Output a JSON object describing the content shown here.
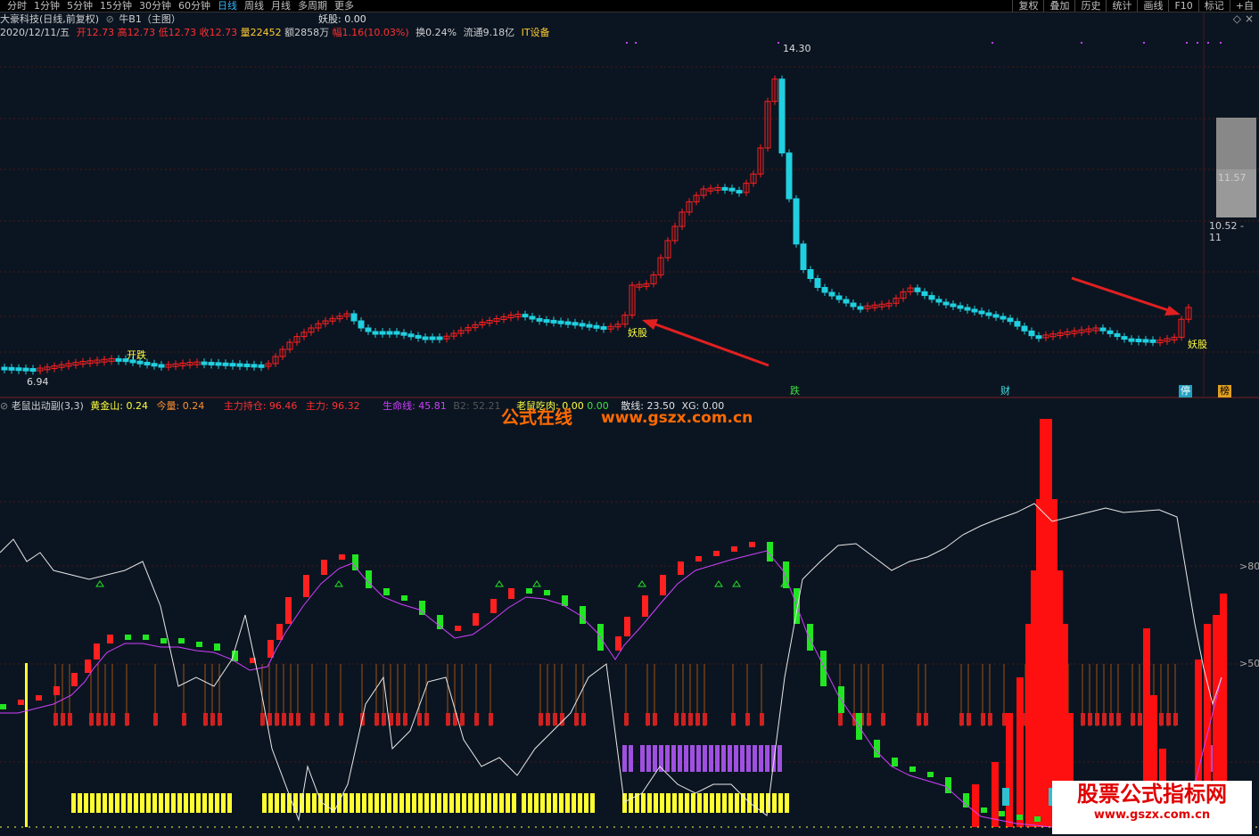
{
  "timeframe_tabs": [
    {
      "label": "分时",
      "active": false
    },
    {
      "label": "1分钟",
      "active": false
    },
    {
      "label": "5分钟",
      "active": false
    },
    {
      "label": "15分钟",
      "active": false
    },
    {
      "label": "30分钟",
      "active": false
    },
    {
      "label": "60分钟",
      "active": false
    },
    {
      "label": "日线",
      "active": true
    },
    {
      "label": "周线",
      "active": false
    },
    {
      "label": "月线",
      "active": false
    },
    {
      "label": "多周期",
      "active": false
    },
    {
      "label": "更多",
      "active": false
    }
  ],
  "right_tools": [
    "复权",
    "叠加",
    "历史",
    "统计",
    "画线",
    "F10",
    "标记",
    "+自"
  ],
  "stock": {
    "title": "大豪科技(日线,前复权)",
    "indicator": "牛B1（主图）",
    "yaogu_label": "妖股: 0.00",
    "date": "2020/12/11/五",
    "open": "开12.73",
    "high": "高12.73",
    "low": "低12.73",
    "close": "收12.73",
    "volume": "量22452",
    "amount": "额2858万",
    "change": "幅1.16(10.03%)",
    "turnover": "换0.24%",
    "float": "流通9.18亿",
    "sector": "IT设备"
  },
  "annotations": {
    "peak_price": "14.30",
    "low_price": "6.94",
    "kaidie": "开跌",
    "yaogu": "妖股",
    "yaogu2": "妖股"
  },
  "markers": [
    "跌",
    "财",
    "停",
    "榜"
  ],
  "price_axis": {
    "label1": "11.57",
    "label2": "10.52 - 11"
  },
  "sub_indicator": {
    "name": "老鼠出动副(3,3)",
    "hjs": "黄金山: 0.24",
    "jl": "今量: 0.24",
    "zlcc": "主力持仓: 96.46",
    "zl": "主力: 96.32",
    "smx": "生命线: 45.81",
    "b2": "B2: 52.21",
    "lsc": "老鼠吃肉: 0.00",
    "lsc2": "0.00",
    "sx": "散线: 23.50",
    "xg": "XG: 0.00"
  },
  "sub_axis": {
    "l80": ">80",
    "l50": ">50"
  },
  "watermarks": {
    "w1": "公式在线",
    "w2": "www.gszx.com.cn",
    "w3": "股票公式指标网",
    "w4": "www.gszx.com.cn"
  },
  "colors": {
    "up": "#ff2020",
    "down": "#20d0e0",
    "bg": "#0b1521",
    "green": "#22e522",
    "yellow": "#ffff30",
    "purple": "#a050e0"
  }
}
